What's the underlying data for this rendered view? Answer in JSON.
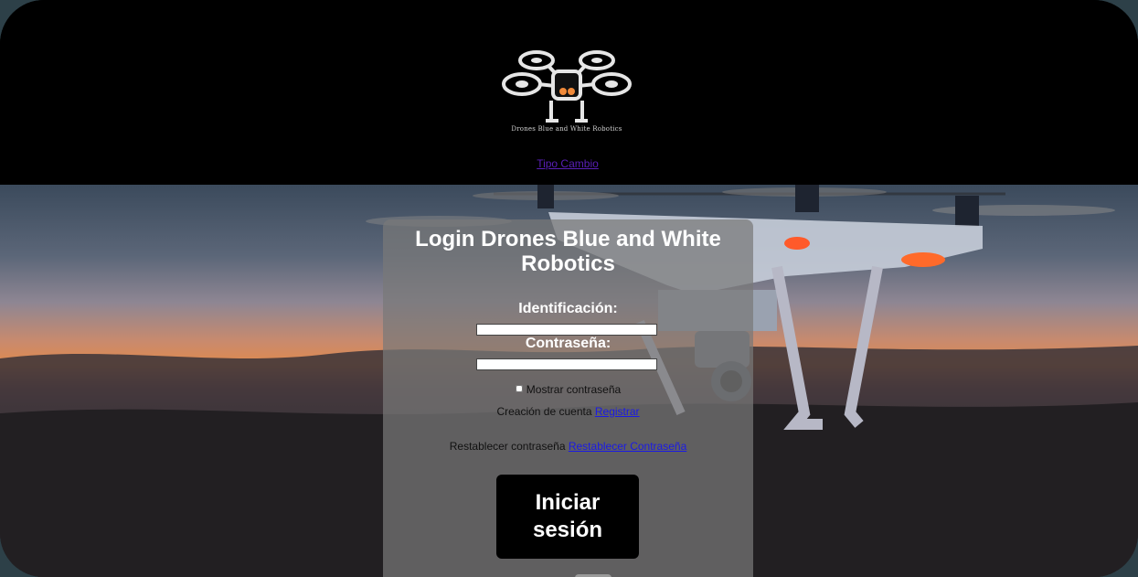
{
  "header": {
    "logo_text": "Drones Blue and White Robotics",
    "tipo_cambio_link": "Tipo Cambio"
  },
  "login": {
    "title": "Login Drones Blue and White Robotics",
    "id_label": "Identificación:",
    "id_value": "",
    "password_label": "Contraseña:",
    "password_value": "",
    "show_password_label": "Mostrar contraseña",
    "create_account_text": "Creación de cuenta",
    "register_link": "Registrar",
    "reset_text": "Restablecer contraseña",
    "reset_link": "Restablecer Contraseña",
    "submit_label": "Iniciar sesión"
  },
  "colors": {
    "header_bg": "#000000",
    "link_purple": "#5a1fb8",
    "link_blue": "#1a1ae6",
    "panel_bg": "rgba(120,120,120,0.72)"
  }
}
